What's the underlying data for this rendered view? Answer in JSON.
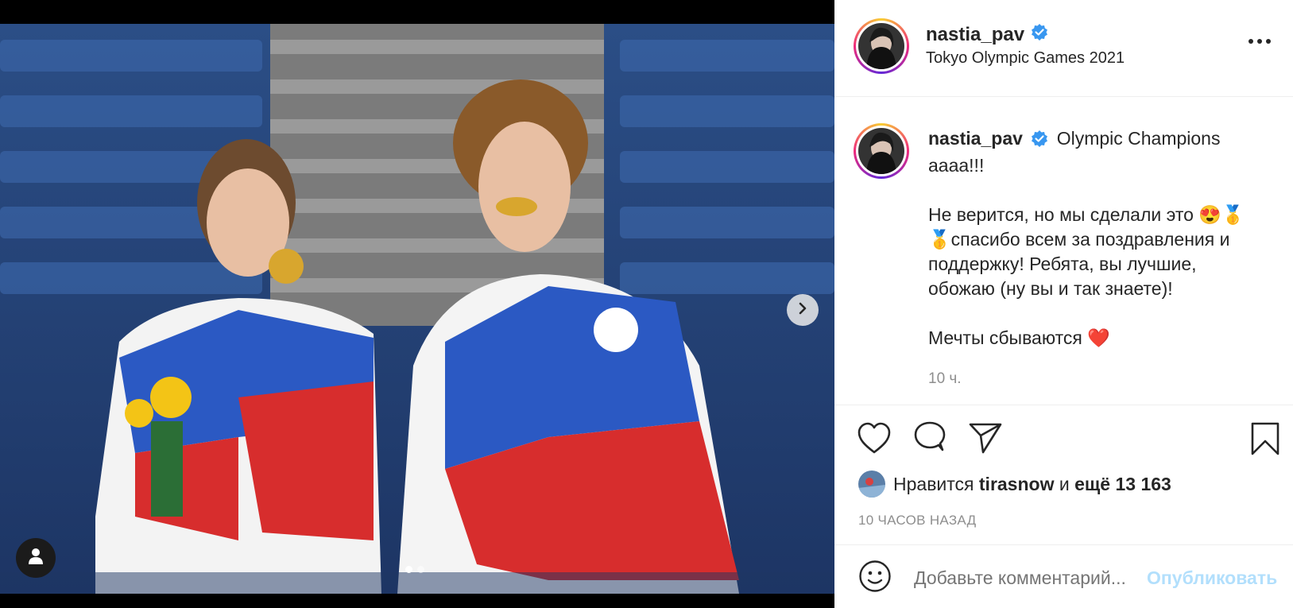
{
  "post": {
    "username": "nastia_pav",
    "location": "Tokyo Olympic Games 2021",
    "more_icon": "more-horizontal-icon",
    "verified_icon": "verified-badge-icon",
    "colors": {
      "verified": "#3897f0",
      "link": "#b2dffc",
      "muted": "#8e8e8e",
      "heart": "#ed4956"
    }
  },
  "media": {
    "photo_description_icon": "photo",
    "carousel_dots": [
      true,
      false
    ],
    "next_icon": "chevron-right-icon",
    "tag_icon": "user-icon"
  },
  "caption": {
    "username": "nastia_pav",
    "line1": "Olympic Champions",
    "line2": "аааа!!!",
    "para2_a": "Не верится, но мы сделали это 😍🥇",
    "para2_b": "🥇спасибо всем за поздравления и",
    "para2_c": "поддержку! Ребята, вы лучшие,",
    "para2_d": "обожаю (ну вы и так знаете)!",
    "para3": "Мечты сбываются",
    "para3_emoji": "❤️",
    "time": "10 ч."
  },
  "actions": {
    "like_icon": "heart-icon",
    "comment_icon": "comment-icon",
    "share_icon": "send-icon",
    "save_icon": "bookmark-icon"
  },
  "likes": {
    "prefix": "Нравится",
    "user": "tirasnow",
    "conj": "и",
    "rest": "ещё 13 163"
  },
  "ago": "10 ЧАСОВ НАЗАД",
  "comment": {
    "emoji_icon": "smiley-icon",
    "placeholder": "Добавьте комментарий...",
    "post_label": "Опубликовать"
  }
}
